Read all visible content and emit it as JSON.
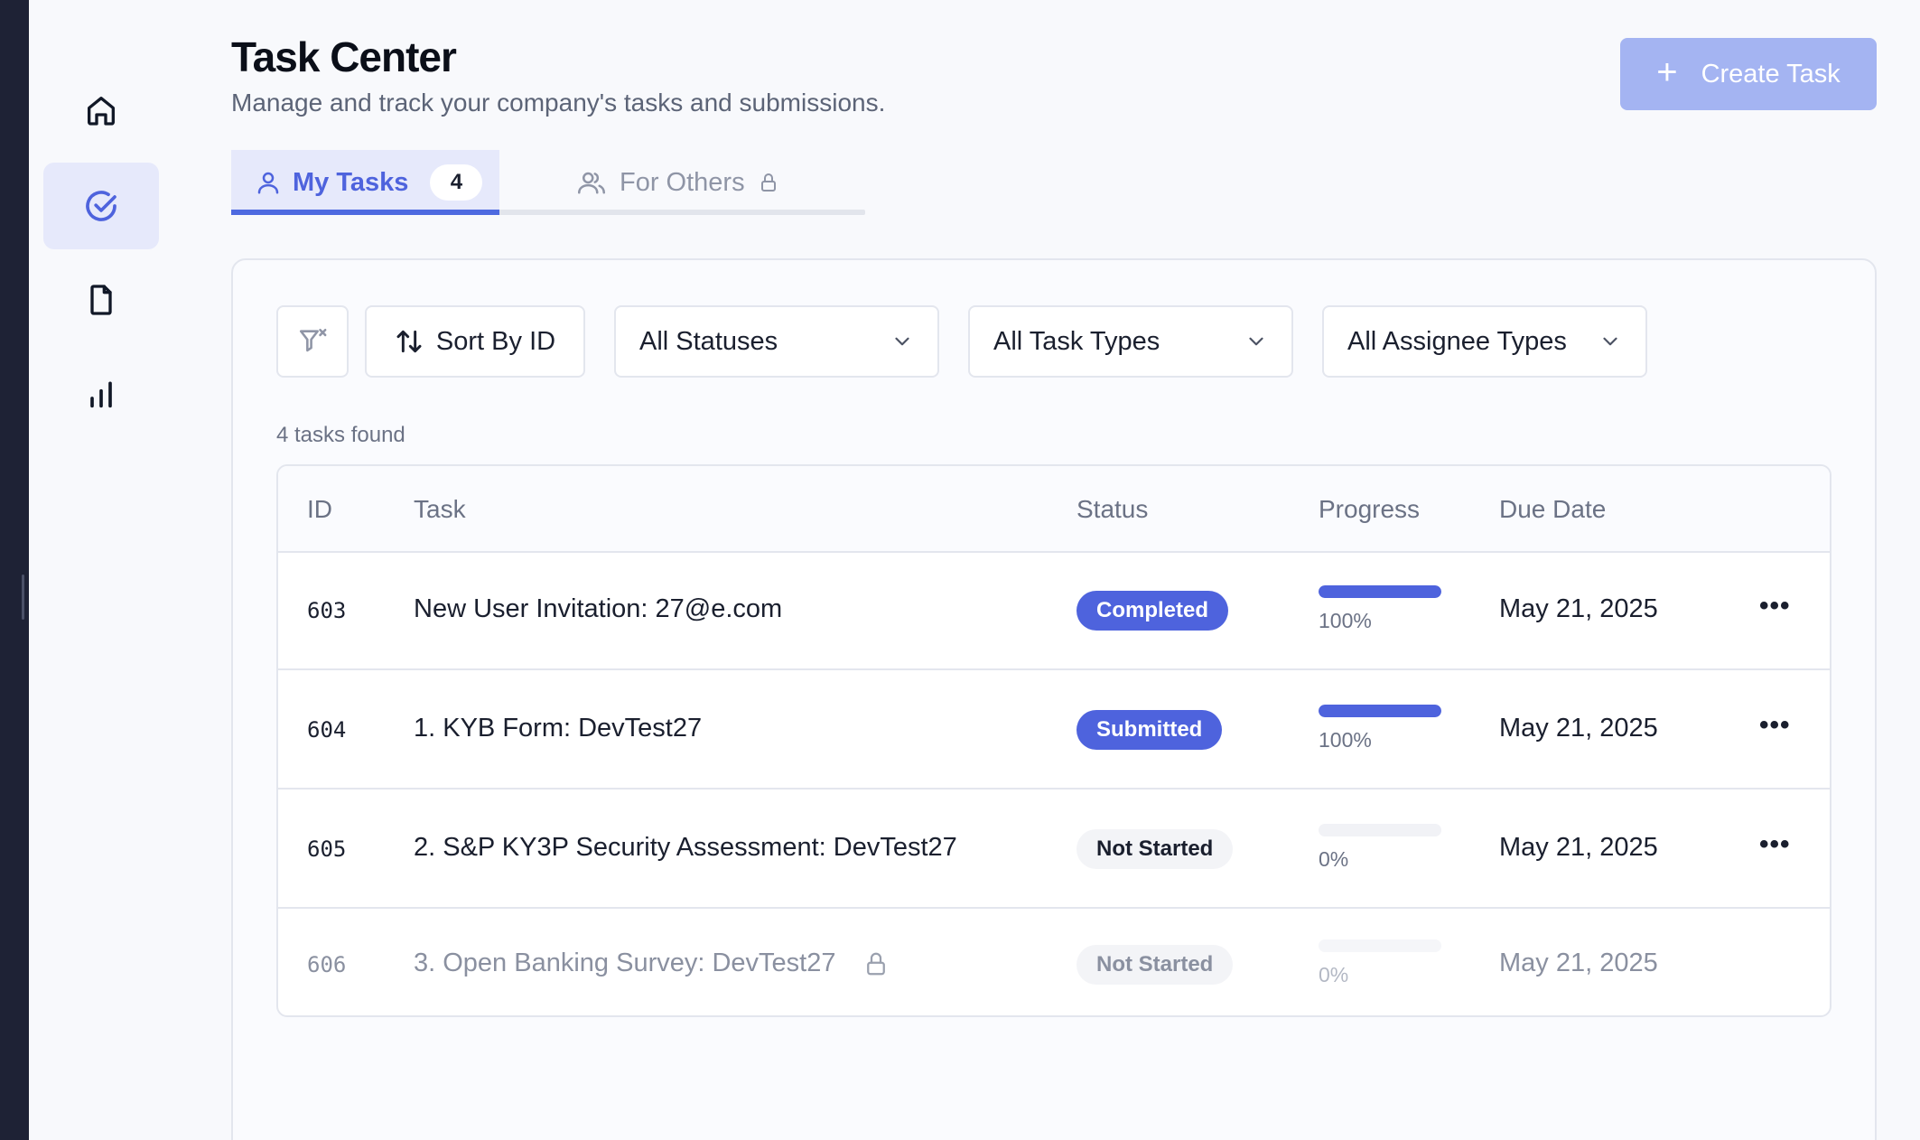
{
  "page": {
    "title": "Task Center",
    "subtitle": "Manage and track your company's tasks and submissions.",
    "create_button": "Create Task"
  },
  "sidebar": {
    "items": [
      {
        "icon": "home-icon",
        "active": false
      },
      {
        "icon": "check-circle-icon",
        "active": true
      },
      {
        "icon": "document-icon",
        "active": false
      },
      {
        "icon": "bar-chart-icon",
        "active": false
      }
    ]
  },
  "tabs": {
    "my_tasks": {
      "label": "My Tasks",
      "count": "4"
    },
    "for_others": {
      "label": "For Others"
    }
  },
  "filters": {
    "sort_label": "Sort By ID",
    "status": "All Statuses",
    "task_type": "All Task Types",
    "assignee_type": "All Assignee Types"
  },
  "results_text": "4 tasks found",
  "table": {
    "headers": {
      "id": "ID",
      "task": "Task",
      "status": "Status",
      "progress": "Progress",
      "due": "Due Date"
    },
    "rows": [
      {
        "id": "603",
        "task": "New User Invitation: 27@e.com",
        "status": "Completed",
        "progress_pct": 100,
        "progress_label": "100%",
        "due": "May 21, 2025",
        "menu": "•••"
      },
      {
        "id": "604",
        "task": "1. KYB Form: DevTest27",
        "status": "Submitted",
        "progress_pct": 100,
        "progress_label": "100%",
        "due": "May 21, 2025",
        "menu": "•••"
      },
      {
        "id": "605",
        "task": "2. S&P KY3P Security Assessment: DevTest27",
        "status": "Not Started",
        "progress_pct": 0,
        "progress_label": "0%",
        "due": "May 21, 2025",
        "menu": "•••"
      },
      {
        "id": "606",
        "task": "3. Open Banking Survey: DevTest27",
        "status": "Not Started",
        "progress_pct": 0,
        "progress_label": "0%",
        "due": "May 21, 2025",
        "locked": true
      }
    ]
  },
  "colors": {
    "accent": "#4e63dd",
    "accent_light": "#e6e9fb",
    "create_button": "#a4b4f2"
  }
}
